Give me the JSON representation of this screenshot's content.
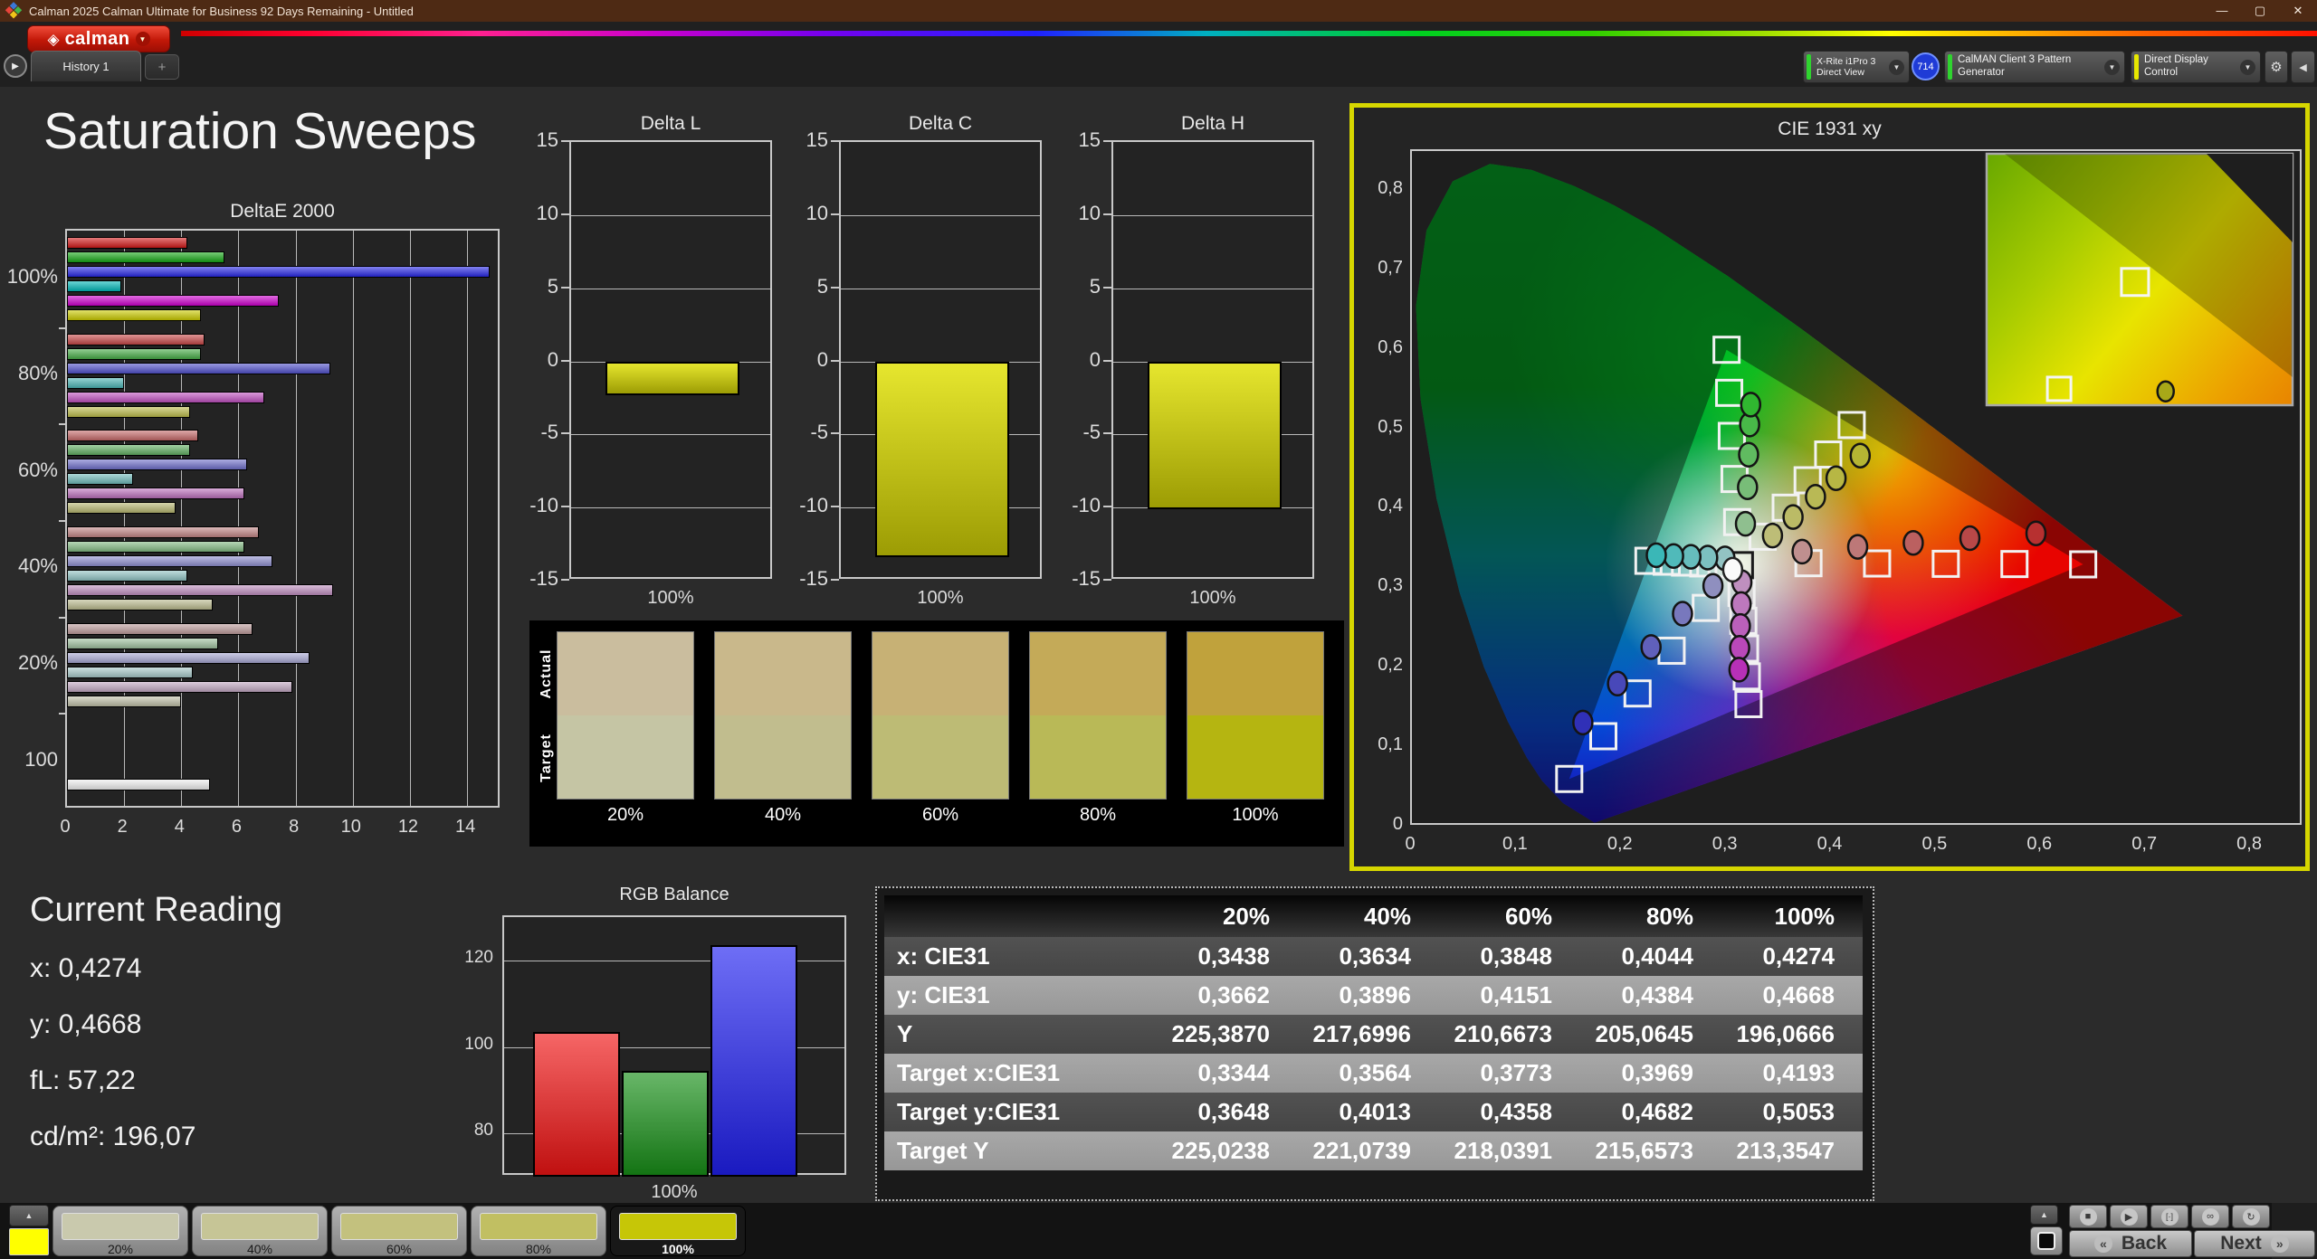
{
  "window": {
    "title": "Calman 2025 Calman Ultimate for Business 92 Days Remaining  - Untitled",
    "minimize": "—",
    "restore": "▢",
    "close": "✕"
  },
  "toolbar": {
    "brand": "calman",
    "history_tab": "History 1",
    "add_tab": "+",
    "meter": {
      "line1": "X-Rite i1Pro 3",
      "line2": "Direct View",
      "badge": "714",
      "status_color": "#2fd42f"
    },
    "generator": {
      "label": "CalMAN Client 3 Pattern Generator",
      "status_color": "#2fd42f"
    },
    "display_control": {
      "label": "Direct Display Control",
      "status_color": "#e8e800"
    }
  },
  "page": {
    "title": "Saturation Sweeps"
  },
  "current_reading": {
    "title": "Current Reading",
    "lines": [
      "x: 0,4274",
      "y: 0,4668",
      "fL: 57,22",
      "cd/m²: 196,07"
    ]
  },
  "footer": {
    "back": "Back",
    "next": "Next",
    "active_color": "#ffff00",
    "selected": "100%",
    "swatches": [
      {
        "label": "20%",
        "color": "#c9c9ad"
      },
      {
        "label": "40%",
        "color": "#c6c596"
      },
      {
        "label": "60%",
        "color": "#c3c17e"
      },
      {
        "label": "80%",
        "color": "#c1bf62"
      },
      {
        "label": "100%",
        "color": "#c6c607"
      }
    ]
  },
  "chart_data": [
    {
      "id": "delta_e",
      "type": "bar",
      "orientation": "horizontal",
      "title": "DeltaE 2000",
      "xlim": [
        0,
        15.2
      ],
      "xticks": [
        0,
        2,
        4,
        6,
        8,
        10,
        12,
        14
      ],
      "series_order": [
        "red",
        "green",
        "blue",
        "cyan",
        "magenta",
        "yellow"
      ],
      "groups": [
        {
          "label": "100%",
          "values": [
            4.2,
            5.5,
            14.8,
            1.9,
            7.4,
            4.7
          ],
          "colors": [
            "#d41a1a",
            "#16a816",
            "#2828e6",
            "#00b8b8",
            "#ce00ce",
            "#cccc00"
          ]
        },
        {
          "label": "80%",
          "values": [
            4.8,
            4.7,
            9.2,
            2.0,
            6.9,
            4.3
          ],
          "colors": [
            "#c94848",
            "#46ad46",
            "#5050cc",
            "#4cb6b6",
            "#c050c0",
            "#bcbc4c"
          ]
        },
        {
          "label": "60%",
          "values": [
            4.6,
            4.3,
            6.3,
            2.3,
            6.2,
            3.8
          ],
          "colors": [
            "#c66a6a",
            "#62b062",
            "#7070cc",
            "#70bcbc",
            "#bd70bd",
            "#b8b870"
          ]
        },
        {
          "label": "40%",
          "values": [
            6.7,
            6.2,
            7.2,
            4.2,
            9.3,
            5.1
          ],
          "colors": [
            "#c28585",
            "#82ba82",
            "#8f8fd0",
            "#90c4c4",
            "#c08fc0",
            "#bcbc8f"
          ]
        },
        {
          "label": "20%",
          "values": [
            6.5,
            5.3,
            8.5,
            4.4,
            7.9,
            4.0
          ],
          "colors": [
            "#bf9d9d",
            "#a0c2a0",
            "#a8a8d4",
            "#a8caca",
            "#c2a8c2",
            "#c0c0a8"
          ]
        },
        {
          "label": "100",
          "values": [
            5.0
          ],
          "colors": [
            "#f0f0f0"
          ]
        }
      ]
    },
    {
      "id": "delta_l",
      "type": "bar",
      "title": "Delta L",
      "ylim": [
        -15,
        15
      ],
      "yticks": [
        15,
        10,
        5,
        0,
        -5,
        -10,
        -15
      ],
      "categories": [
        "100%"
      ],
      "values": [
        -2.3
      ],
      "color": "#d6d61c"
    },
    {
      "id": "delta_c",
      "type": "bar",
      "title": "Delta C",
      "ylim": [
        -15,
        15
      ],
      "yticks": [
        15,
        10,
        5,
        0,
        -5,
        -10,
        -15
      ],
      "categories": [
        "100%"
      ],
      "values": [
        -13.4
      ],
      "color": "#d6d61c"
    },
    {
      "id": "delta_h",
      "type": "bar",
      "title": "Delta H",
      "ylim": [
        -15,
        15
      ],
      "yticks": [
        15,
        10,
        5,
        0,
        -5,
        -10,
        -15
      ],
      "categories": [
        "100%"
      ],
      "values": [
        -10.1
      ],
      "color": "#d6d61c"
    },
    {
      "id": "swatch_compare",
      "type": "table",
      "row_labels": [
        "Actual",
        "Target"
      ],
      "columns": [
        "20%",
        "40%",
        "60%",
        "80%",
        "100%"
      ],
      "actual_colors": [
        "#cabd9e",
        "#c9b88b",
        "#c7b175",
        "#c4aa58",
        "#c0a23c"
      ],
      "target_colors": [
        "#c5c5a4",
        "#c1bd8e",
        "#bdbb75",
        "#b9b957",
        "#b5b511"
      ]
    },
    {
      "id": "cie1931",
      "type": "scatter",
      "title": "CIE 1931 xy",
      "xlim": [
        0,
        0.85
      ],
      "ylim": [
        0,
        0.85
      ],
      "tick_values": [
        0,
        0.1,
        0.2,
        0.3,
        0.4,
        0.5,
        0.6,
        0.7,
        0.8
      ],
      "tick_labels": [
        "0",
        "0,1",
        "0,2",
        "0,3",
        "0,4",
        "0,5",
        "0,6",
        "0,7",
        "0,8"
      ],
      "gamut_triangle": {
        "red": [
          0.64,
          0.33
        ],
        "green": [
          0.3,
          0.6
        ],
        "blue": [
          0.15,
          0.06
        ]
      },
      "white_point": [
        0.3127,
        0.329
      ],
      "targets": {
        "red": [
          [
            0.3781,
            0.3315
          ],
          [
            0.4435,
            0.3311
          ],
          [
            0.509,
            0.3307
          ],
          [
            0.5745,
            0.3304
          ],
          [
            0.64,
            0.33
          ]
        ],
        "green": [
          [
            0.3101,
            0.3832
          ],
          [
            0.3076,
            0.4374
          ],
          [
            0.305,
            0.4916
          ],
          [
            0.3025,
            0.5458
          ],
          [
            0.3,
            0.6
          ]
        ],
        "blue": [
          [
            0.2802,
            0.2752
          ],
          [
            0.2476,
            0.2214
          ],
          [
            0.2151,
            0.1676
          ],
          [
            0.1825,
            0.1138
          ],
          [
            0.15,
            0.06
          ]
        ],
        "cyan": [
          [
            0.2953,
            0.3301
          ],
          [
            0.2778,
            0.3312
          ],
          [
            0.2604,
            0.3323
          ],
          [
            0.2429,
            0.3334
          ],
          [
            0.2255,
            0.3345
          ]
        ],
        "magenta": [
          [
            0.3143,
            0.294
          ],
          [
            0.316,
            0.259
          ],
          [
            0.3176,
            0.2241
          ],
          [
            0.3193,
            0.1891
          ],
          [
            0.3209,
            0.1542
          ]
        ],
        "yellow": [
          [
            0.3344,
            0.3648
          ],
          [
            0.3564,
            0.4013
          ],
          [
            0.3773,
            0.4358
          ],
          [
            0.3969,
            0.4682
          ],
          [
            0.4193,
            0.5053
          ]
        ]
      },
      "measurements": {
        "red": [
          [
            0.372,
            0.346
          ],
          [
            0.425,
            0.352
          ],
          [
            0.478,
            0.357
          ],
          [
            0.532,
            0.363
          ],
          [
            0.595,
            0.369
          ]
        ],
        "green": [
          [
            0.318,
            0.381
          ],
          [
            0.32,
            0.427
          ],
          [
            0.321,
            0.468
          ],
          [
            0.322,
            0.506
          ],
          [
            0.323,
            0.531
          ]
        ],
        "blue": [
          [
            0.287,
            0.303
          ],
          [
            0.258,
            0.268
          ],
          [
            0.228,
            0.226
          ],
          [
            0.196,
            0.18
          ],
          [
            0.163,
            0.131
          ]
        ],
        "cyan": [
          [
            0.2985,
            0.3375
          ],
          [
            0.282,
            0.3385
          ],
          [
            0.266,
            0.3395
          ],
          [
            0.2495,
            0.3405
          ],
          [
            0.233,
            0.3415
          ]
        ],
        "magenta": [
          [
            0.3146,
            0.3075
          ],
          [
            0.3139,
            0.28
          ],
          [
            0.3132,
            0.2525
          ],
          [
            0.3125,
            0.225
          ],
          [
            0.3118,
            0.1975
          ]
        ],
        "yellow": [
          [
            0.3438,
            0.3662
          ],
          [
            0.3634,
            0.3896
          ],
          [
            0.3848,
            0.4151
          ],
          [
            0.4044,
            0.4384
          ],
          [
            0.4274,
            0.4668
          ]
        ]
      },
      "marker_colors": {
        "red": [
          "#bf8f8f",
          "#bd7878",
          "#bb6060",
          "#b94848",
          "#b73030"
        ],
        "green": [
          "#8fbf8f",
          "#78bd78",
          "#60bb60",
          "#48b948",
          "#30b730"
        ],
        "blue": [
          "#8f8fbf",
          "#7878bd",
          "#6060bb",
          "#4848b9",
          "#3030b7"
        ],
        "cyan": [
          "#93c3c3",
          "#7cc0c0",
          "#66bdbd",
          "#50baba",
          "#3ab7b7"
        ],
        "magenta": [
          "#bf8fbf",
          "#bd78bd",
          "#bb60bb",
          "#b948b9",
          "#b730b7"
        ],
        "yellow": [
          "#bdbd77",
          "#bbbb66",
          "#b9b955",
          "#b7b744",
          "#b5b533"
        ]
      },
      "inset": {
        "squares": [
          {
            "fx": 0.485,
            "fy": 0.51,
            "s": 30
          },
          {
            "fx": 0.237,
            "fy": 0.935,
            "s": 26
          }
        ],
        "circle": {
          "fx": 0.585,
          "fy": 0.945,
          "color": "#a8a818"
        }
      }
    },
    {
      "id": "rgb_balance",
      "type": "bar",
      "title": "RGB Balance",
      "ylim": [
        70,
        130
      ],
      "yticks": [
        80,
        100,
        120
      ],
      "categories": [
        "Red",
        "Green",
        "Blue"
      ],
      "values": [
        103.5,
        94.5,
        123.5
      ],
      "colors": [
        "#f01414",
        "#189018",
        "#2020f0"
      ],
      "xlabel": "100%"
    },
    {
      "id": "results_table",
      "type": "table",
      "columns": [
        "20%",
        "40%",
        "60%",
        "80%",
        "100%"
      ],
      "rows": [
        {
          "label": "x: CIE31",
          "values": [
            "0,3438",
            "0,3634",
            "0,3848",
            "0,4044",
            "0,4274"
          ]
        },
        {
          "label": "y: CIE31",
          "values": [
            "0,3662",
            "0,3896",
            "0,4151",
            "0,4384",
            "0,4668"
          ]
        },
        {
          "label": "Y",
          "values": [
            "225,3870",
            "217,6996",
            "210,6673",
            "205,0645",
            "196,0666"
          ]
        },
        {
          "label": "Target x:CIE31",
          "values": [
            "0,3344",
            "0,3564",
            "0,3773",
            "0,3969",
            "0,4193"
          ]
        },
        {
          "label": "Target y:CIE31",
          "values": [
            "0,3648",
            "0,4013",
            "0,4358",
            "0,4682",
            "0,5053"
          ]
        },
        {
          "label": "Target Y",
          "values": [
            "225,0238",
            "221,0739",
            "218,0391",
            "215,6573",
            "213,3547"
          ]
        }
      ]
    }
  ]
}
